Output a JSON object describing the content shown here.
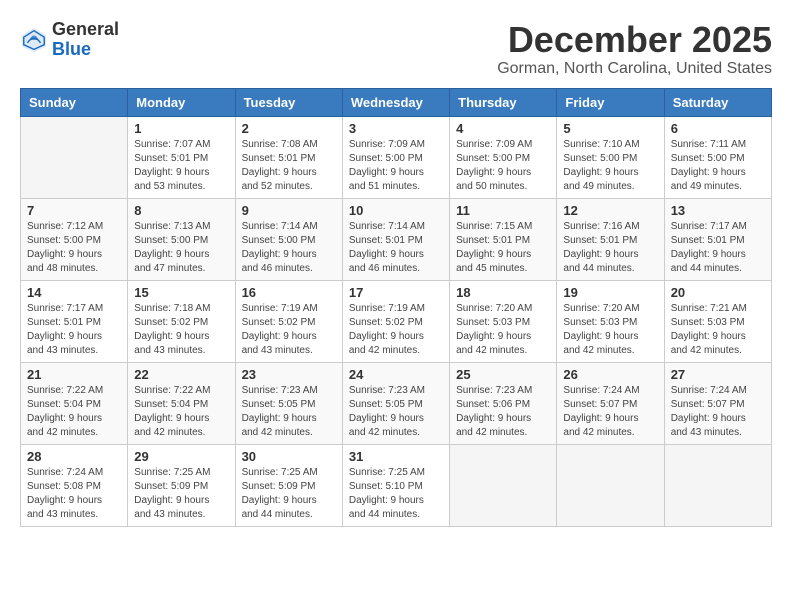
{
  "header": {
    "logo_general": "General",
    "logo_blue": "Blue",
    "month": "December 2025",
    "location": "Gorman, North Carolina, United States"
  },
  "days_of_week": [
    "Sunday",
    "Monday",
    "Tuesday",
    "Wednesday",
    "Thursday",
    "Friday",
    "Saturday"
  ],
  "weeks": [
    [
      {
        "day": "",
        "info": ""
      },
      {
        "day": "1",
        "info": "Sunrise: 7:07 AM\nSunset: 5:01 PM\nDaylight: 9 hours\nand 53 minutes."
      },
      {
        "day": "2",
        "info": "Sunrise: 7:08 AM\nSunset: 5:01 PM\nDaylight: 9 hours\nand 52 minutes."
      },
      {
        "day": "3",
        "info": "Sunrise: 7:09 AM\nSunset: 5:00 PM\nDaylight: 9 hours\nand 51 minutes."
      },
      {
        "day": "4",
        "info": "Sunrise: 7:09 AM\nSunset: 5:00 PM\nDaylight: 9 hours\nand 50 minutes."
      },
      {
        "day": "5",
        "info": "Sunrise: 7:10 AM\nSunset: 5:00 PM\nDaylight: 9 hours\nand 49 minutes."
      },
      {
        "day": "6",
        "info": "Sunrise: 7:11 AM\nSunset: 5:00 PM\nDaylight: 9 hours\nand 49 minutes."
      }
    ],
    [
      {
        "day": "7",
        "info": "Sunrise: 7:12 AM\nSunset: 5:00 PM\nDaylight: 9 hours\nand 48 minutes."
      },
      {
        "day": "8",
        "info": "Sunrise: 7:13 AM\nSunset: 5:00 PM\nDaylight: 9 hours\nand 47 minutes."
      },
      {
        "day": "9",
        "info": "Sunrise: 7:14 AM\nSunset: 5:00 PM\nDaylight: 9 hours\nand 46 minutes."
      },
      {
        "day": "10",
        "info": "Sunrise: 7:14 AM\nSunset: 5:01 PM\nDaylight: 9 hours\nand 46 minutes."
      },
      {
        "day": "11",
        "info": "Sunrise: 7:15 AM\nSunset: 5:01 PM\nDaylight: 9 hours\nand 45 minutes."
      },
      {
        "day": "12",
        "info": "Sunrise: 7:16 AM\nSunset: 5:01 PM\nDaylight: 9 hours\nand 44 minutes."
      },
      {
        "day": "13",
        "info": "Sunrise: 7:17 AM\nSunset: 5:01 PM\nDaylight: 9 hours\nand 44 minutes."
      }
    ],
    [
      {
        "day": "14",
        "info": "Sunrise: 7:17 AM\nSunset: 5:01 PM\nDaylight: 9 hours\nand 43 minutes."
      },
      {
        "day": "15",
        "info": "Sunrise: 7:18 AM\nSunset: 5:02 PM\nDaylight: 9 hours\nand 43 minutes."
      },
      {
        "day": "16",
        "info": "Sunrise: 7:19 AM\nSunset: 5:02 PM\nDaylight: 9 hours\nand 43 minutes."
      },
      {
        "day": "17",
        "info": "Sunrise: 7:19 AM\nSunset: 5:02 PM\nDaylight: 9 hours\nand 42 minutes."
      },
      {
        "day": "18",
        "info": "Sunrise: 7:20 AM\nSunset: 5:03 PM\nDaylight: 9 hours\nand 42 minutes."
      },
      {
        "day": "19",
        "info": "Sunrise: 7:20 AM\nSunset: 5:03 PM\nDaylight: 9 hours\nand 42 minutes."
      },
      {
        "day": "20",
        "info": "Sunrise: 7:21 AM\nSunset: 5:03 PM\nDaylight: 9 hours\nand 42 minutes."
      }
    ],
    [
      {
        "day": "21",
        "info": "Sunrise: 7:22 AM\nSunset: 5:04 PM\nDaylight: 9 hours\nand 42 minutes."
      },
      {
        "day": "22",
        "info": "Sunrise: 7:22 AM\nSunset: 5:04 PM\nDaylight: 9 hours\nand 42 minutes."
      },
      {
        "day": "23",
        "info": "Sunrise: 7:23 AM\nSunset: 5:05 PM\nDaylight: 9 hours\nand 42 minutes."
      },
      {
        "day": "24",
        "info": "Sunrise: 7:23 AM\nSunset: 5:05 PM\nDaylight: 9 hours\nand 42 minutes."
      },
      {
        "day": "25",
        "info": "Sunrise: 7:23 AM\nSunset: 5:06 PM\nDaylight: 9 hours\nand 42 minutes."
      },
      {
        "day": "26",
        "info": "Sunrise: 7:24 AM\nSunset: 5:07 PM\nDaylight: 9 hours\nand 42 minutes."
      },
      {
        "day": "27",
        "info": "Sunrise: 7:24 AM\nSunset: 5:07 PM\nDaylight: 9 hours\nand 43 minutes."
      }
    ],
    [
      {
        "day": "28",
        "info": "Sunrise: 7:24 AM\nSunset: 5:08 PM\nDaylight: 9 hours\nand 43 minutes."
      },
      {
        "day": "29",
        "info": "Sunrise: 7:25 AM\nSunset: 5:09 PM\nDaylight: 9 hours\nand 43 minutes."
      },
      {
        "day": "30",
        "info": "Sunrise: 7:25 AM\nSunset: 5:09 PM\nDaylight: 9 hours\nand 44 minutes."
      },
      {
        "day": "31",
        "info": "Sunrise: 7:25 AM\nSunset: 5:10 PM\nDaylight: 9 hours\nand 44 minutes."
      },
      {
        "day": "",
        "info": ""
      },
      {
        "day": "",
        "info": ""
      },
      {
        "day": "",
        "info": ""
      }
    ]
  ]
}
